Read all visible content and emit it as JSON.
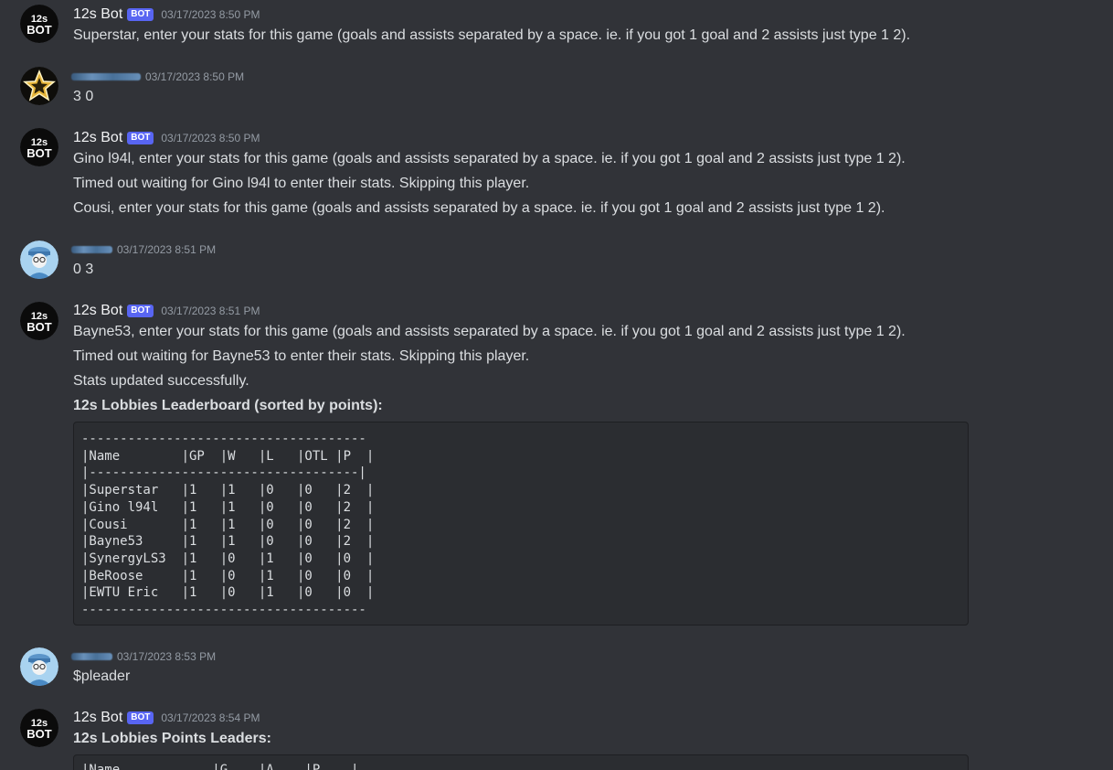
{
  "messages": [
    {
      "author": "12s Bot",
      "bot_tag": "BOT",
      "timestamp": "03/17/2023 8:50 PM",
      "lines": [
        "Superstar, enter your stats for this game (goals and assists separated by a space. ie. if you got 1 goal and 2 assists just type 1 2)."
      ]
    },
    {
      "author": "",
      "timestamp": "03/17/2023 8:50 PM",
      "lines": [
        "3 0"
      ]
    },
    {
      "author": "12s Bot",
      "bot_tag": "BOT",
      "timestamp": "03/17/2023 8:50 PM",
      "lines": [
        "Gino l94l, enter your stats for this game (goals and assists separated by a space. ie. if you got 1 goal and 2 assists just type 1 2).",
        "Timed out waiting for Gino l94l to enter their stats. Skipping this player.",
        "Cousi, enter your stats for this game (goals and assists separated by a space. ie. if you got 1 goal and 2 assists just type 1 2)."
      ]
    },
    {
      "author": "",
      "timestamp": "03/17/2023 8:51 PM",
      "lines": [
        "0 3"
      ]
    },
    {
      "author": "12s Bot",
      "bot_tag": "BOT",
      "timestamp": "03/17/2023 8:51 PM",
      "lines": [
        "Bayne53, enter your stats for this game (goals and assists separated by a space. ie. if you got 1 goal and 2 assists just type 1 2).",
        "Timed out waiting for Bayne53 to enter their stats. Skipping this player.",
        "Stats updated successfully.",
        "12s Lobbies Leaderboard (sorted by points):"
      ],
      "code": "-------------------------------------\n|Name        |GP  |W   |L   |OTL |P  |\n|-----------------------------------|\n|Superstar   |1   |1   |0   |0   |2  |\n|Gino l94l   |1   |1   |0   |0   |2  |\n|Cousi       |1   |1   |0   |0   |2  |\n|Bayne53     |1   |1   |0   |0   |2  |\n|SynergyLS3  |1   |0   |1   |0   |0  |\n|BeRoose     |1   |0   |1   |0   |0  |\n|EWTU Eric   |1   |0   |1   |0   |0  |\n-------------------------------------"
    },
    {
      "author": "",
      "timestamp": "03/17/2023 8:53 PM",
      "lines": [
        "$pleader"
      ]
    },
    {
      "author": "12s Bot",
      "bot_tag": "BOT",
      "timestamp": "03/17/2023 8:54 PM",
      "lines": [
        "12s Lobbies Points Leaders:"
      ],
      "code": "|Name            |G    |A    |P    |"
    }
  ],
  "avatar_text": {
    "line1": "12s",
    "line2": "BOT"
  },
  "colors": {
    "background": "#313338",
    "codeblock": "#2b2d31",
    "bot_tag": "#5865f2",
    "timestamp": "#949ba4",
    "text": "#dbdee1"
  },
  "icons": {
    "bot_avatar": "12s-bot-logo-icon",
    "star_avatar": "gold-star-icon",
    "cartoon_avatar": "cartoon-person-icon"
  }
}
